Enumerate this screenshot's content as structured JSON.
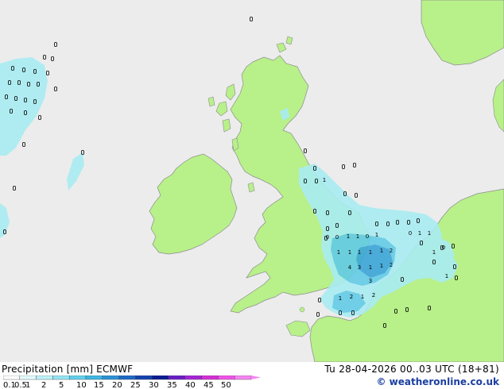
{
  "map": {
    "sea_color": "#ececec",
    "land_color": "#b8f08a",
    "coast_color": "#8c8c8c",
    "precip_light": "#a9ecf2",
    "precip_mid": "#63cbe6",
    "precip_heavy": "#3ba6d8"
  },
  "values": [
    "1",
    "0",
    "0",
    "1",
    "1",
    "0",
    "1",
    "0",
    "1",
    "1",
    "1",
    "1",
    "1",
    "1",
    "1",
    "2",
    "4",
    "3",
    "1",
    "1",
    "2",
    "3",
    "1",
    "2",
    "1",
    "2",
    "0",
    "1",
    "1"
  ],
  "footer": {
    "title": "Precipitation [mm] ECMWF",
    "date": "Tu 28-04-2026 00..03 UTC (18+81)",
    "credit": "© weatheronline.co.uk"
  },
  "legend": {
    "labels": [
      "0.1",
      "0.5",
      "1",
      "2",
      "5",
      "10",
      "15",
      "20",
      "25",
      "30",
      "35",
      "40",
      "45",
      "50"
    ],
    "colors": [
      "#ffffff",
      "#e2fafc",
      "#bdf1f8",
      "#93e4f3",
      "#62d0ec",
      "#3eb6e2",
      "#2c92d6",
      "#1d6ac4",
      "#1443ad",
      "#0b1d91",
      "#6a1ec8",
      "#a624d6",
      "#d42fd6",
      "#f052e8",
      "#f586f2"
    ]
  }
}
